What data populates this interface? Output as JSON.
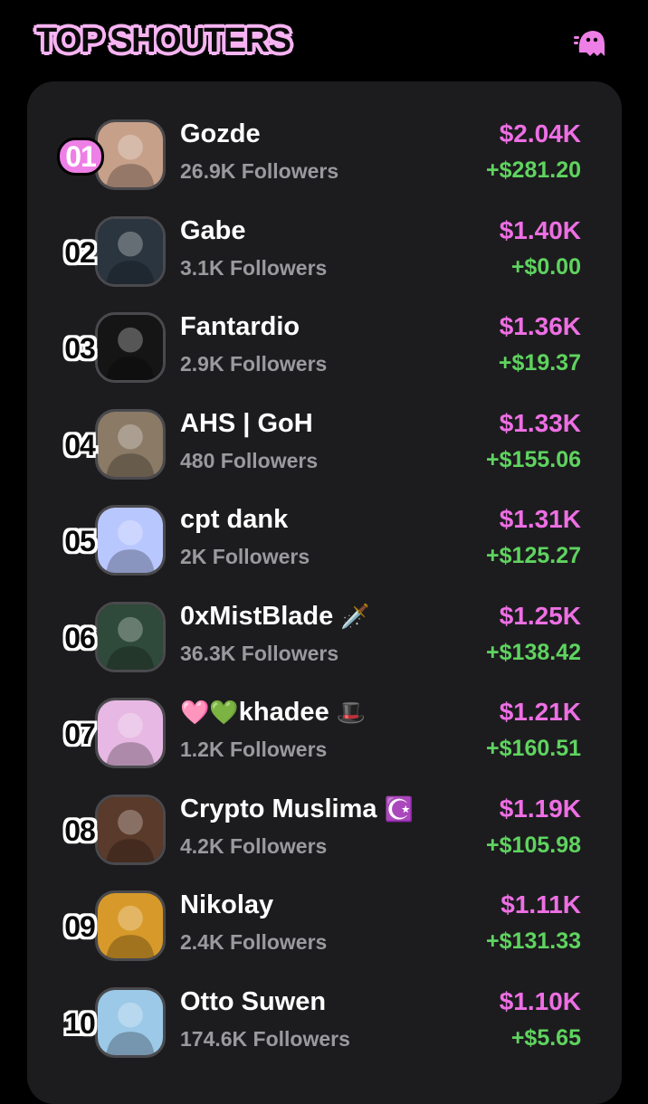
{
  "header": {
    "title": "TOP SHOUTERS",
    "mascot_icon": "pink-ghost-mascot-icon"
  },
  "colors": {
    "accent_pink": "#ee6fe4",
    "positive_green": "#5fd35f",
    "muted_gray": "#9a9a9e",
    "panel_bg": "#1c1c1e"
  },
  "rows": [
    {
      "rank": "01",
      "name": "Gozde",
      "followers": "26.9K Followers",
      "amount": "$2.04K",
      "delta": "+$281.20",
      "avatar_color": "#c7a08a"
    },
    {
      "rank": "02",
      "name": "Gabe",
      "followers": "3.1K Followers",
      "amount": "$1.40K",
      "delta": "+$0.00",
      "avatar_color": "#2a3540"
    },
    {
      "rank": "03",
      "name": "Fantardio",
      "followers": "2.9K Followers",
      "amount": "$1.36K",
      "delta": "+$19.37",
      "avatar_color": "#151515"
    },
    {
      "rank": "04",
      "name": "AHS | GoH",
      "followers": "480 Followers",
      "amount": "$1.33K",
      "delta": "+$155.06",
      "avatar_color": "#8a7a66"
    },
    {
      "rank": "05",
      "name": "cpt dank",
      "followers": "2K Followers",
      "amount": "$1.31K",
      "delta": "+$125.27",
      "avatar_color": "#b9c7ff"
    },
    {
      "rank": "06",
      "name": "0xMistBlade",
      "name_emoji": "🗡️",
      "followers": "36.3K Followers",
      "amount": "$1.25K",
      "delta": "+$138.42",
      "avatar_color": "#2f4a3a"
    },
    {
      "rank": "07",
      "name": "khadee",
      "name_prefix": "🩷💚",
      "name_emoji": "🎩",
      "followers": "1.2K Followers",
      "amount": "$1.21K",
      "delta": "+$160.51",
      "avatar_color": "#e7b8e3"
    },
    {
      "rank": "08",
      "name": "Crypto Muslima",
      "name_emoji": "☪️",
      "followers": "4.2K Followers",
      "amount": "$1.19K",
      "delta": "+$105.98",
      "avatar_color": "#5a3a2a"
    },
    {
      "rank": "09",
      "name": "Nikolay",
      "followers": "2.4K Followers",
      "amount": "$1.11K",
      "delta": "+$131.33",
      "avatar_color": "#d79a2a"
    },
    {
      "rank": "10",
      "name": "Otto Suwen",
      "followers": "174.6K Followers",
      "amount": "$1.10K",
      "delta": "+$5.65",
      "avatar_color": "#9cc9e8"
    }
  ]
}
